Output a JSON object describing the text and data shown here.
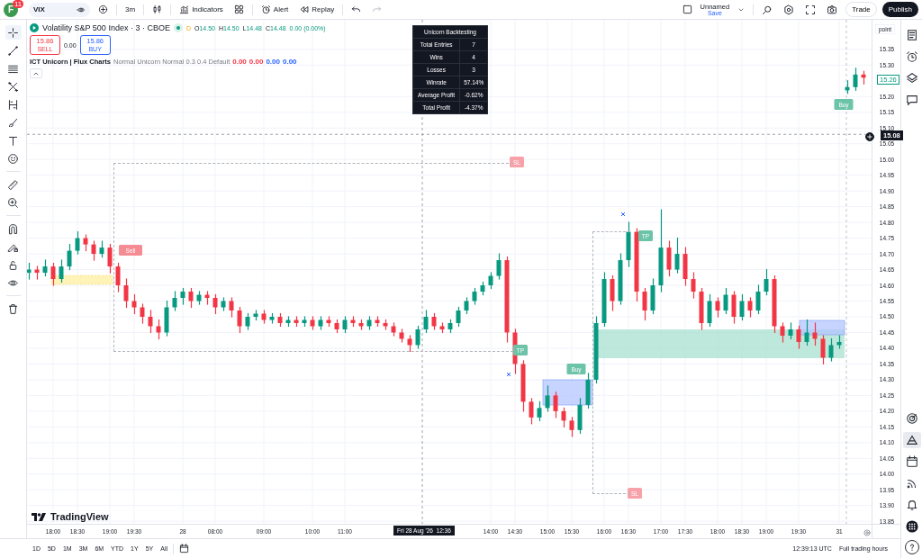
{
  "top_bar": {
    "avatar_letter": "F",
    "notification_count": "11",
    "symbol": "VIX",
    "interval": "3m",
    "indicators": "Indicators",
    "alert": "Alert",
    "replay": "Replay",
    "layout_name": "Unnamed",
    "layout_status": "Save",
    "trade": "Trade",
    "publish": "Publish"
  },
  "left_toolbar": {
    "tools": [
      {
        "selected": true
      },
      {
        "selected": false
      },
      {
        "selected": false
      },
      {
        "selected": false
      },
      {
        "selected": false
      },
      {
        "selected": false
      },
      {
        "selected": false
      },
      {
        "selected": false
      },
      {
        "selected": false
      },
      {
        "selected": false
      },
      {
        "selected": false
      },
      {
        "selected": false
      },
      {
        "selected": false
      },
      {
        "selected": false
      },
      {
        "selected": false
      }
    ]
  },
  "legend": {
    "title": "Volatility S&P 500 Index · 3 · CBOE",
    "market_status": "D",
    "ohlc": [
      {
        "label": "O",
        "value": "14.50"
      },
      {
        "label": "H",
        "value": "14.50"
      },
      {
        "label": "L",
        "value": "14.48"
      },
      {
        "label": "C",
        "value": "14.48"
      }
    ],
    "change": "0.00 (0.00%)",
    "sell_price": "15.86",
    "sell": "SELL",
    "spread": "0.00",
    "buy_price": "15.86",
    "buy": "BUY",
    "indicator_name": "ICT Unicorn | Flux Charts",
    "indicator_params": "Normal Unicorn Normal 0.3 0.4 Default",
    "indicator_values": [
      {
        "text": "0.00",
        "color": "#f23645"
      },
      {
        "text": "0.00",
        "color": "#f23645"
      },
      {
        "text": "0.00",
        "color": "#2962ff"
      },
      {
        "text": "0.00",
        "color": "#2962ff"
      }
    ]
  },
  "backtest_table": {
    "title": "Unicorn Backtesting",
    "rows": [
      {
        "label": "Total Entries",
        "value": "7"
      },
      {
        "label": "Wins",
        "value": "4"
      },
      {
        "label": "Losses",
        "value": "3"
      },
      {
        "label": "Winrate",
        "value": "57.14%"
      },
      {
        "label": "Average Profit",
        "value": "-0.62%"
      },
      {
        "label": "Total Profit",
        "value": "-4.37%"
      }
    ]
  },
  "chart": {
    "chart_data": {
      "type": "candlestick",
      "categories": [
        null,
        null,
        null,
        "18:00",
        null,
        null,
        "18:30",
        null,
        null,
        null,
        "19:00",
        null,
        null,
        "19:30",
        null,
        null,
        null,
        null,
        null,
        "28",
        null,
        null,
        null,
        "08:00",
        null,
        null,
        null,
        null,
        null,
        "09:00",
        null,
        null,
        null,
        null,
        null,
        "10:00",
        null,
        null,
        null,
        "11:00",
        null,
        null,
        null,
        null,
        null,
        null,
        null,
        null,
        null,
        null,
        null,
        null,
        null,
        null,
        null,
        null,
        null,
        "14:00",
        null,
        null,
        "14:30",
        null,
        null,
        null,
        "15:00",
        null,
        null,
        "15:30",
        null,
        null,
        null,
        "16:00",
        null,
        null,
        "16:30",
        null,
        null,
        null,
        "17:00",
        null,
        null,
        "17:30",
        null,
        null,
        null,
        "18:00",
        null,
        null,
        "18:30",
        null,
        null,
        "19:00",
        null,
        null,
        null,
        "19:30",
        null,
        null,
        null,
        null,
        "31",
        null,
        null,
        null
      ],
      "ohlc": [
        [
          14.64,
          14.67,
          14.62,
          14.65
        ],
        [
          14.65,
          14.66,
          14.62,
          14.64
        ],
        [
          14.64,
          14.68,
          14.63,
          14.66
        ],
        [
          14.66,
          14.67,
          14.6,
          14.62
        ],
        [
          14.62,
          14.68,
          14.61,
          14.66
        ],
        [
          14.66,
          14.73,
          14.65,
          14.71
        ],
        [
          14.71,
          14.77,
          14.7,
          14.75
        ],
        [
          14.75,
          14.76,
          14.71,
          14.73
        ],
        [
          14.73,
          14.74,
          14.68,
          14.7
        ],
        [
          14.7,
          14.74,
          14.69,
          14.72
        ],
        [
          14.72,
          14.73,
          14.64,
          14.66
        ],
        [
          14.66,
          14.67,
          14.58,
          14.6
        ],
        [
          14.6,
          14.62,
          14.53,
          14.55
        ],
        [
          14.55,
          14.57,
          14.51,
          14.53
        ],
        [
          14.53,
          14.54,
          14.48,
          14.5
        ],
        [
          14.5,
          14.52,
          14.45,
          14.47
        ],
        [
          14.47,
          14.49,
          14.43,
          14.45
        ],
        [
          14.45,
          14.55,
          14.44,
          14.53
        ],
        [
          14.53,
          14.58,
          14.52,
          14.56
        ],
        [
          14.56,
          14.59,
          14.54,
          14.58
        ],
        [
          14.58,
          14.59,
          14.53,
          14.55
        ],
        [
          14.55,
          14.58,
          14.54,
          14.57
        ],
        [
          14.57,
          14.58,
          14.54,
          14.56
        ],
        [
          14.56,
          14.57,
          14.51,
          14.53
        ],
        [
          14.53,
          14.56,
          14.52,
          14.55
        ],
        [
          14.55,
          14.56,
          14.5,
          14.52
        ],
        [
          14.52,
          14.53,
          14.45,
          14.47
        ],
        [
          14.47,
          14.51,
          14.46,
          14.5
        ],
        [
          14.5,
          14.52,
          14.49,
          14.51
        ],
        [
          14.51,
          14.52,
          14.48,
          14.49
        ],
        [
          14.49,
          14.51,
          14.48,
          14.5
        ],
        [
          14.5,
          14.51,
          14.47,
          14.48
        ],
        [
          14.48,
          14.5,
          14.47,
          14.49
        ],
        [
          14.49,
          14.5,
          14.47,
          14.48
        ],
        [
          14.48,
          14.5,
          14.47,
          14.49
        ],
        [
          14.49,
          14.5,
          14.46,
          14.47
        ],
        [
          14.47,
          14.5,
          14.46,
          14.49
        ],
        [
          14.49,
          14.5,
          14.47,
          14.48
        ],
        [
          14.48,
          14.49,
          14.45,
          14.46
        ],
        [
          14.46,
          14.5,
          14.45,
          14.49
        ],
        [
          14.49,
          14.5,
          14.47,
          14.48
        ],
        [
          14.48,
          14.49,
          14.46,
          14.47
        ],
        [
          14.47,
          14.5,
          14.46,
          14.49
        ],
        [
          14.49,
          14.5,
          14.47,
          14.48
        ],
        [
          14.48,
          14.49,
          14.46,
          14.47
        ],
        [
          14.47,
          14.48,
          14.44,
          14.45
        ],
        [
          14.45,
          14.46,
          14.42,
          14.43
        ],
        [
          14.43,
          14.44,
          14.39,
          14.41
        ],
        [
          14.41,
          14.47,
          14.4,
          14.46
        ],
        [
          14.46,
          14.52,
          14.45,
          14.5
        ],
        [
          14.5,
          14.51,
          14.46,
          14.47
        ],
        [
          14.47,
          14.48,
          14.45,
          14.46
        ],
        [
          14.46,
          14.49,
          14.45,
          14.48
        ],
        [
          14.48,
          14.53,
          14.47,
          14.52
        ],
        [
          14.52,
          14.56,
          14.51,
          14.55
        ],
        [
          14.55,
          14.59,
          14.54,
          14.58
        ],
        [
          14.58,
          14.61,
          14.57,
          14.6
        ],
        [
          14.6,
          14.64,
          14.59,
          14.63
        ],
        [
          14.63,
          14.7,
          14.62,
          14.68
        ],
        [
          14.68,
          14.69,
          14.42,
          14.45
        ],
        [
          14.45,
          14.46,
          14.32,
          14.35
        ],
        [
          14.35,
          14.36,
          14.2,
          14.23
        ],
        [
          14.23,
          14.24,
          14.16,
          14.18
        ],
        [
          14.18,
          14.23,
          14.17,
          14.21
        ],
        [
          14.21,
          14.28,
          14.2,
          14.25
        ],
        [
          14.25,
          14.26,
          14.18,
          14.2
        ],
        [
          14.2,
          14.21,
          14.15,
          14.17
        ],
        [
          14.17,
          14.18,
          14.12,
          14.14
        ],
        [
          14.14,
          14.24,
          14.13,
          14.22
        ],
        [
          14.22,
          14.32,
          14.21,
          14.3
        ],
        [
          14.3,
          14.5,
          14.29,
          14.48
        ],
        [
          14.48,
          14.64,
          14.47,
          14.62
        ],
        [
          14.62,
          14.63,
          14.52,
          14.55
        ],
        [
          14.55,
          14.7,
          14.54,
          14.68
        ],
        [
          14.68,
          14.8,
          14.66,
          14.77
        ],
        [
          14.77,
          14.78,
          14.55,
          14.58
        ],
        [
          14.58,
          14.59,
          14.49,
          14.52
        ],
        [
          14.52,
          14.62,
          14.51,
          14.6
        ],
        [
          14.6,
          14.84,
          14.58,
          14.72
        ],
        [
          14.72,
          14.74,
          14.63,
          14.65
        ],
        [
          14.65,
          14.75,
          14.64,
          14.7
        ],
        [
          14.7,
          14.72,
          14.6,
          14.62
        ],
        [
          14.62,
          14.64,
          14.56,
          14.58
        ],
        [
          14.58,
          14.59,
          14.46,
          14.48
        ],
        [
          14.48,
          14.57,
          14.47,
          14.55
        ],
        [
          14.55,
          14.56,
          14.5,
          14.52
        ],
        [
          14.52,
          14.59,
          14.51,
          14.57
        ],
        [
          14.57,
          14.58,
          14.48,
          14.5
        ],
        [
          14.5,
          14.57,
          14.49,
          14.55
        ],
        [
          14.55,
          14.56,
          14.5,
          14.52
        ],
        [
          14.52,
          14.6,
          14.51,
          14.58
        ],
        [
          14.58,
          14.65,
          14.57,
          14.62
        ],
        [
          14.62,
          14.63,
          14.45,
          14.47
        ],
        [
          14.47,
          14.48,
          14.42,
          14.44
        ],
        [
          14.44,
          14.48,
          14.43,
          14.46
        ],
        [
          14.46,
          14.47,
          14.4,
          14.42
        ],
        [
          14.42,
          14.49,
          14.41,
          14.45
        ],
        [
          14.45,
          14.48,
          14.41,
          14.43
        ],
        [
          14.43,
          14.44,
          14.35,
          14.37
        ],
        [
          14.37,
          14.43,
          14.36,
          14.41
        ],
        [
          14.41,
          14.44,
          14.4,
          14.42
        ],
        [
          15.22,
          15.25,
          15.21,
          15.23
        ],
        [
          15.23,
          15.29,
          15.22,
          15.27
        ],
        [
          15.27,
          15.28,
          15.24,
          15.26
        ]
      ],
      "ylim": [
        13.842,
        15.444
      ],
      "yticks": [
        {
          "value": 15.35,
          "label": "15.35"
        },
        {
          "value": 15.3,
          "label": "15.30"
        },
        {
          "value": 15.2,
          "label": "15.20"
        },
        {
          "value": 15.15,
          "label": "15.15"
        },
        {
          "value": 15.1,
          "label": "15.10"
        },
        {
          "value": 15.05,
          "label": "15.05"
        },
        {
          "value": 15,
          "label": "15.00"
        },
        {
          "value": 14.95,
          "label": "14.95"
        },
        {
          "value": 14.9,
          "label": "14.90"
        },
        {
          "value": 14.85,
          "label": "14.85"
        },
        {
          "value": 14.8,
          "label": "14.80"
        },
        {
          "value": 14.75,
          "label": "14.75"
        },
        {
          "value": 14.7,
          "label": "14.70"
        },
        {
          "value": 14.65,
          "label": "14.65"
        },
        {
          "value": 14.6,
          "label": "14.60"
        },
        {
          "value": 14.55,
          "label": "14.55"
        },
        {
          "value": 14.5,
          "label": "14.50"
        },
        {
          "value": 14.45,
          "label": "14.45"
        },
        {
          "value": 14.4,
          "label": "14.40"
        },
        {
          "value": 14.35,
          "label": "14.35"
        },
        {
          "value": 14.3,
          "label": "14.30"
        },
        {
          "value": 14.25,
          "label": "14.25"
        },
        {
          "value": 14.2,
          "label": "14.20"
        },
        {
          "value": 14.15,
          "label": "14.15"
        },
        {
          "value": 14.1,
          "label": "14.10"
        },
        {
          "value": 14.05,
          "label": "14.05"
        },
        {
          "value": 14,
          "label": "14.00"
        },
        {
          "value": 13.95,
          "label": "13.95"
        },
        {
          "value": 13.9,
          "label": "13.90"
        },
        {
          "value": 13.85,
          "label": "13.85"
        }
      ],
      "grid": true,
      "ref_lines": [
        {
          "axis": "y",
          "value": 15.08
        }
      ]
    },
    "markers": [
      {
        "kind": "sell",
        "text": "Sell"
      },
      {
        "kind": "sl",
        "text": "SL"
      },
      {
        "kind": "tp",
        "text": "TP"
      },
      {
        "kind": "buy",
        "text": "Buy"
      },
      {
        "kind": "tp",
        "text": "TP"
      },
      {
        "kind": "sl",
        "text": "SL"
      },
      {
        "kind": "buy",
        "text": "Buy"
      }
    ],
    "price_axis": {
      "unit": "point",
      "last_price": "15.26",
      "crosshair_price": "15.08"
    },
    "time_axis": {
      "crosshair_time": "Fri 28 Aug '26  12:36"
    },
    "branding": "TradingView"
  },
  "bottom_bar": {
    "ranges": [
      "1D",
      "5D",
      "1M",
      "3M",
      "6M",
      "YTD",
      "1Y",
      "5Y",
      "All"
    ],
    "clock": "12:39:13 UTC",
    "session": "Full trading hours"
  },
  "right_sidebar": {
    "items": [
      {
        "selected": false
      },
      {
        "selected": false
      },
      {
        "selected": false
      },
      {
        "selected": false
      },
      {
        "selected": false
      },
      {
        "selected": true
      },
      {
        "selected": false
      },
      {
        "selected": false
      },
      {
        "selected": false
      },
      {
        "selected": false
      }
    ]
  }
}
